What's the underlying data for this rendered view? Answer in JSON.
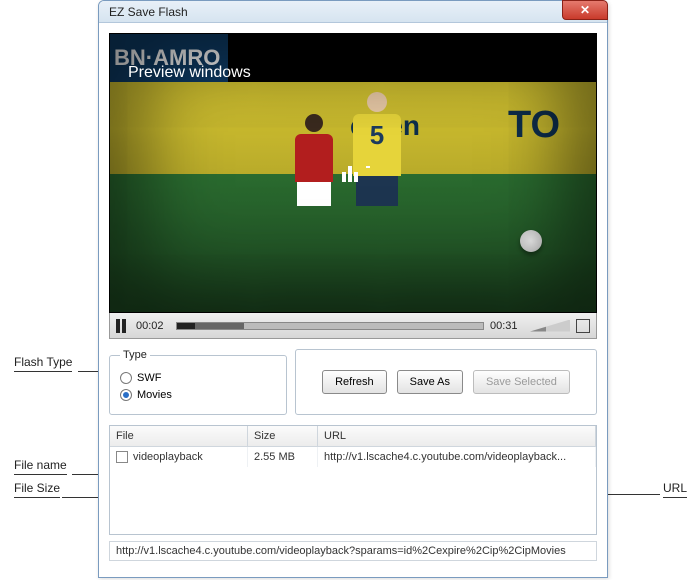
{
  "window": {
    "title": "EZ Save Flash"
  },
  "preview": {
    "overlay_text": "Preview windows",
    "scene": {
      "left_text": "BN·AMRO",
      "board_text_1": "eizen",
      "board_text_2": "TO",
      "player_number": "5"
    }
  },
  "player": {
    "time_current": "00:02",
    "time_total": "00:31"
  },
  "type_group": {
    "legend": "Type",
    "options": [
      {
        "label": "SWF",
        "checked": false
      },
      {
        "label": "Movies",
        "checked": true
      }
    ]
  },
  "buttons": {
    "refresh": "Refresh",
    "save_as": "Save As",
    "save_selected": "Save Selected"
  },
  "grid": {
    "headers": {
      "file": "File",
      "size": "Size",
      "url": "URL"
    },
    "rows": [
      {
        "file": "videoplayback",
        "size": "2.55 MB",
        "url": "http://v1.lscache4.c.youtube.com/videoplayback..."
      }
    ]
  },
  "statusbar": "http://v1.lscache4.c.youtube.com/videoplayback?sparams=id%2Cexpire%2Cip%2CipMovies",
  "callouts": {
    "flash_type": "Flash Type",
    "file_name": "File name",
    "file_size": "File Size",
    "url": "URL"
  }
}
